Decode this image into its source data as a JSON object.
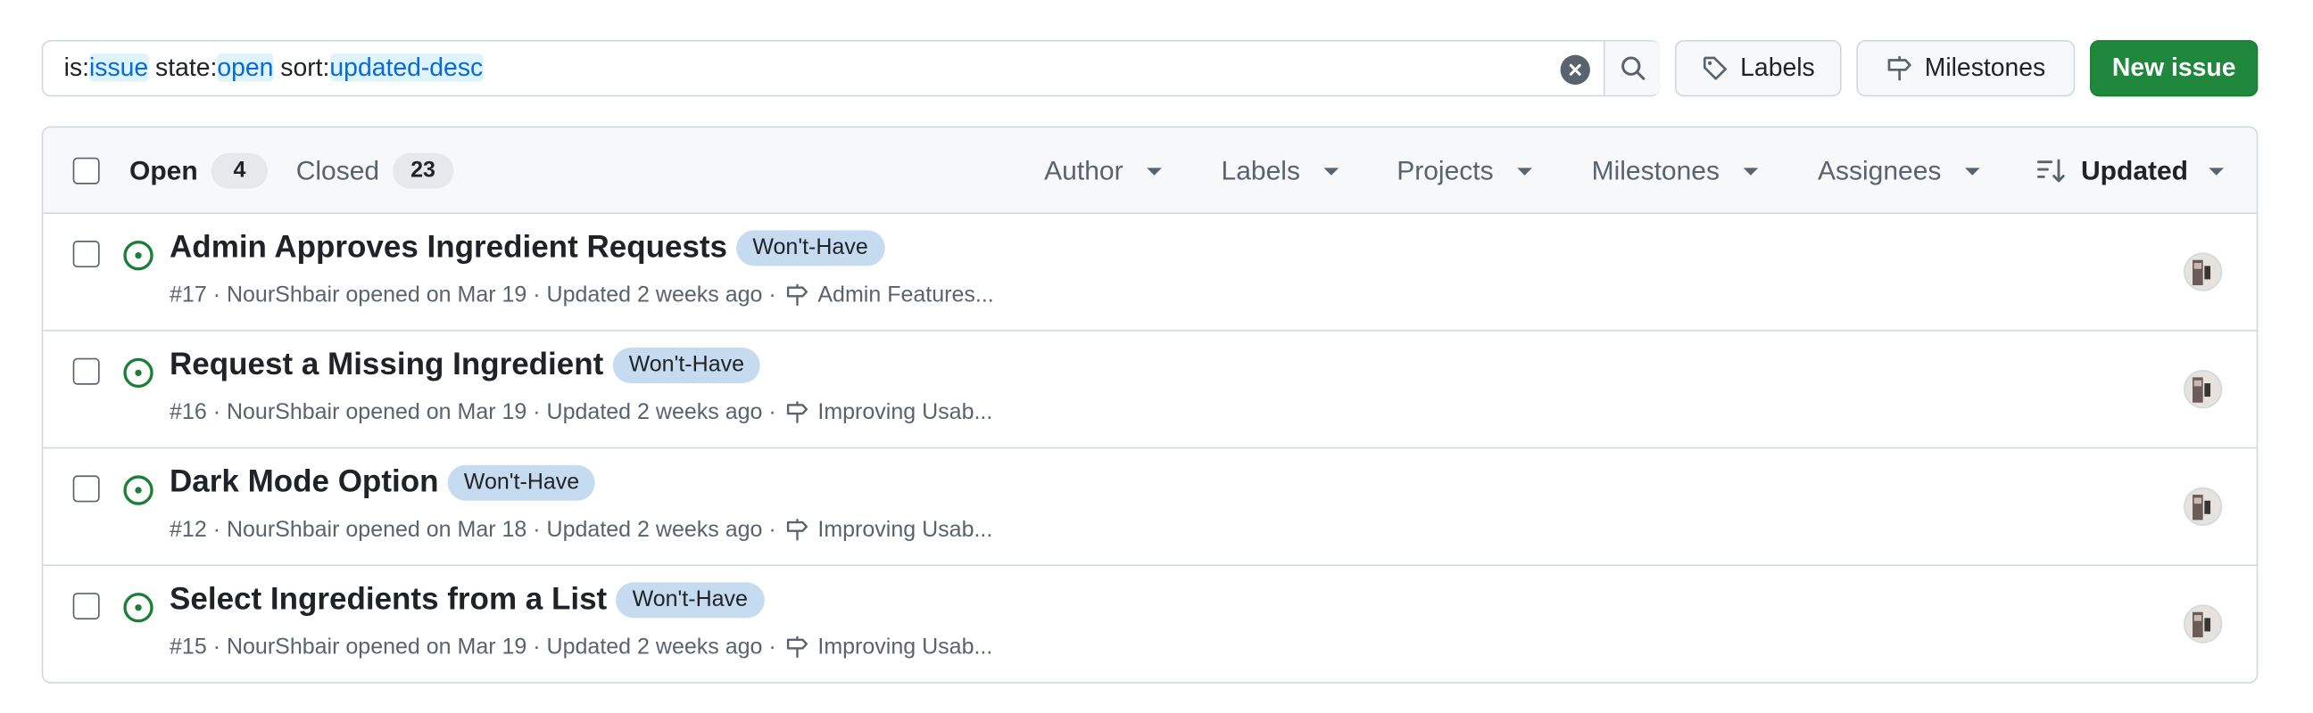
{
  "search": {
    "tokens": [
      {
        "text": "is:",
        "hl": false
      },
      {
        "text": "issue",
        "hl": true
      },
      {
        "text": " state:",
        "hl": false
      },
      {
        "text": "open",
        "hl": true
      },
      {
        "text": " sort:",
        "hl": false
      },
      {
        "text": "updated-desc",
        "hl": true
      }
    ]
  },
  "toolbar": {
    "labels_label": "Labels",
    "milestones_label": "Milestones",
    "new_issue_label": "New issue"
  },
  "tabs": {
    "open_label": "Open",
    "open_count": "4",
    "closed_label": "Closed",
    "closed_count": "23"
  },
  "filters": {
    "author": "Author",
    "labels": "Labels",
    "projects": "Projects",
    "milestones": "Milestones",
    "assignees": "Assignees",
    "sort": "Updated"
  },
  "issues": [
    {
      "title": "Admin Approves Ingredient Requests",
      "label": "Won't-Have",
      "meta": "#17 · NourShbair opened on Mar 19 · Updated 2 weeks ago ·",
      "milestone": "Admin Features..."
    },
    {
      "title": "Request a Missing Ingredient",
      "label": "Won't-Have",
      "meta": "#16 · NourShbair opened on Mar 19 · Updated 2 weeks ago ·",
      "milestone": "Improving Usab..."
    },
    {
      "title": "Dark Mode Option",
      "label": "Won't-Have",
      "meta": "#12 · NourShbair opened on Mar 18 · Updated 2 weeks ago ·",
      "milestone": "Improving Usab..."
    },
    {
      "title": "Select Ingredients from a List",
      "label": "Won't-Have",
      "meta": "#15 · NourShbair opened on Mar 19 · Updated 2 weeks ago ·",
      "milestone": "Improving Usab..."
    }
  ],
  "colors": {
    "accent_green": "#1f883d",
    "open_icon": "#1a7f37",
    "label_bg": "#c6dbf0",
    "link_blue": "#0969da"
  }
}
